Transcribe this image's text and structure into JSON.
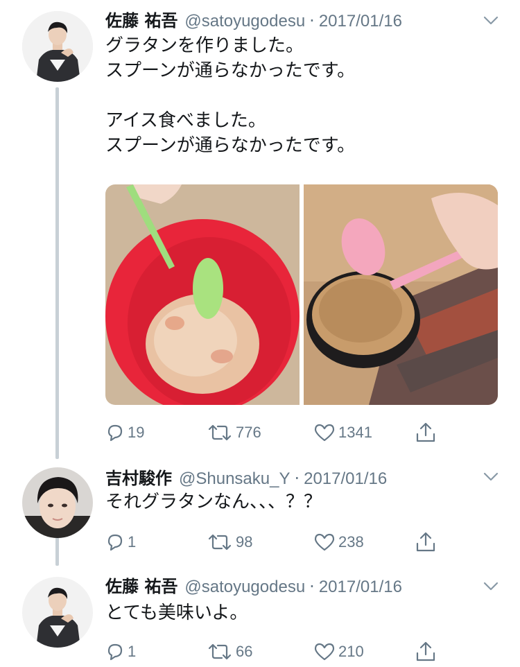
{
  "tweets": [
    {
      "name": "佐藤 祐吾",
      "handle": "@satoyugodesu",
      "separator": "·",
      "date": "2017/01/16",
      "text": "グラタンを作りました。\nスプーンが通らなかったです。\n\nアイス食べました。\nスプーンが通らなかったです。",
      "replies": "19",
      "retweets": "776",
      "likes": "1341",
      "media": [
        {
          "icon": "gratin-photo",
          "description_color": "#e8253a"
        },
        {
          "icon": "ice-cream-photo",
          "description_color": "#c9a27a"
        }
      ]
    },
    {
      "name": "吉村駿作",
      "handle": "@Shunsaku_Y",
      "separator": "·",
      "date": "2017/01/16",
      "text": "それグラタンなん、、、？？",
      "replies": "1",
      "retweets": "98",
      "likes": "238"
    },
    {
      "name": "佐藤 祐吾",
      "handle": "@satoyugodesu",
      "separator": "·",
      "date": "2017/01/16",
      "text": "とても美味いよ。",
      "replies": "1",
      "retweets": "66",
      "likes": "210"
    }
  ],
  "icons": {
    "reply": "reply-icon",
    "retweet": "retweet-icon",
    "like": "heart-icon",
    "share": "share-icon",
    "caret": "chevron-down-icon"
  },
  "colors": {
    "text": "#14171a",
    "secondary": "#657786",
    "thread_line": "#c8d0d6"
  }
}
